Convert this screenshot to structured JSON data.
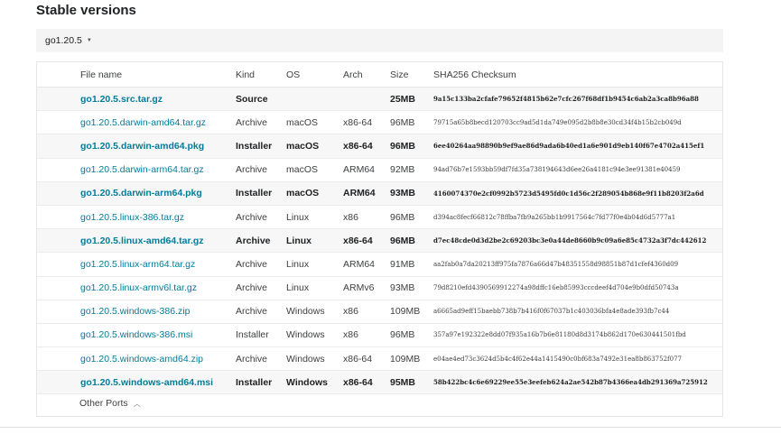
{
  "section_title": "Stable versions",
  "version_select": {
    "value": "go1.20.5"
  },
  "table": {
    "headers": [
      "File name",
      "Kind",
      "OS",
      "Arch",
      "Size",
      "SHA256 Checksum"
    ],
    "rows": [
      {
        "name": "go1.20.5.src.tar.gz",
        "kind": "Source",
        "os": "",
        "arch": "",
        "size": "25MB",
        "sha": "9a15c133ba2cfafe79652f4815b62e7cfc267f68df1b9454c6ab2a3ca8b96a88",
        "highlight": true
      },
      {
        "name": "go1.20.5.darwin-amd64.tar.gz",
        "kind": "Archive",
        "os": "macOS",
        "arch": "x86-64",
        "size": "96MB",
        "sha": "79715a65b8becd120703cc9ad5d1da749e095d2b8b8e30cd34f4b15b2cb049d",
        "highlight": false
      },
      {
        "name": "go1.20.5.darwin-amd64.pkg",
        "kind": "Installer",
        "os": "macOS",
        "arch": "x86-64",
        "size": "96MB",
        "sha": "6ee40264aa98890b9ef9ae86d9ada6b40ed1a6e901d9eb140f67e4702a415ef1",
        "highlight": true
      },
      {
        "name": "go1.20.5.darwin-arm64.tar.gz",
        "kind": "Archive",
        "os": "macOS",
        "arch": "ARM64",
        "size": "92MB",
        "sha": "94ad76b7e1593bb59df7fd35a738194643d6ee26a4181c94e3ee91381e40459",
        "highlight": false
      },
      {
        "name": "go1.20.5.darwin-arm64.pkg",
        "kind": "Installer",
        "os": "macOS",
        "arch": "ARM64",
        "size": "93MB",
        "sha": "4160074370e2cf0992b5723d5495fd0c1d56c2f289054b868e9f11b8203f2a6d",
        "highlight": true
      },
      {
        "name": "go1.20.5.linux-386.tar.gz",
        "kind": "Archive",
        "os": "Linux",
        "arch": "x86",
        "size": "96MB",
        "sha": "d394ac8fecf66812c78ffba7fb9a265bb1b9917564c7fd77f0e4b04d6d5777a1",
        "highlight": false
      },
      {
        "name": "go1.20.5.linux-amd64.tar.gz",
        "kind": "Archive",
        "os": "Linux",
        "arch": "x86-64",
        "size": "96MB",
        "sha": "d7ec48cde0d3d2be2c69203bc3e0a44de8660b9c09a6e85c4732a3f7dc442612",
        "highlight": true
      },
      {
        "name": "go1.20.5.linux-arm64.tar.gz",
        "kind": "Archive",
        "os": "Linux",
        "arch": "ARM64",
        "size": "91MB",
        "sha": "aa2fab0a7da20213ff975fa7876a66d47b48351558d98851b87d1cfef4360d09",
        "highlight": false
      },
      {
        "name": "go1.20.5.linux-armv6l.tar.gz",
        "kind": "Archive",
        "os": "Linux",
        "arch": "ARMv6",
        "size": "93MB",
        "sha": "79d8210efd4390569912274a98dffc16eb85993cccdeef4d704e9b0dfd50743a",
        "highlight": false
      },
      {
        "name": "go1.20.5.windows-386.zip",
        "kind": "Archive",
        "os": "Windows",
        "arch": "x86",
        "size": "109MB",
        "sha": "a6665ad9eff15baebb738b7b416f0f67037b1c403036bfa4e8ade393fb7c44",
        "highlight": false
      },
      {
        "name": "go1.20.5.windows-386.msi",
        "kind": "Installer",
        "os": "Windows",
        "arch": "x86",
        "size": "96MB",
        "sha": "357a97e192322e8dd07f935a16b7b6e81180d8d3174b862d170e630441501fbd",
        "highlight": false
      },
      {
        "name": "go1.20.5.windows-amd64.zip",
        "kind": "Archive",
        "os": "Windows",
        "arch": "x86-64",
        "size": "109MB",
        "sha": "e04ae4ed73c3624d5b4c4f62e44a1415490c0bf683a7492e31ea8b863752f077",
        "highlight": false
      },
      {
        "name": "go1.20.5.windows-amd64.msi",
        "kind": "Installer",
        "os": "Windows",
        "arch": "x86-64",
        "size": "95MB",
        "sha": "58b422bc4c6e69229ee55e3eefeb624a2ae542b87b4366ea4db291369a725912",
        "highlight": true
      }
    ]
  },
  "other_ports": {
    "label": "Other Ports",
    "icon": "chevron-up-icon"
  }
}
